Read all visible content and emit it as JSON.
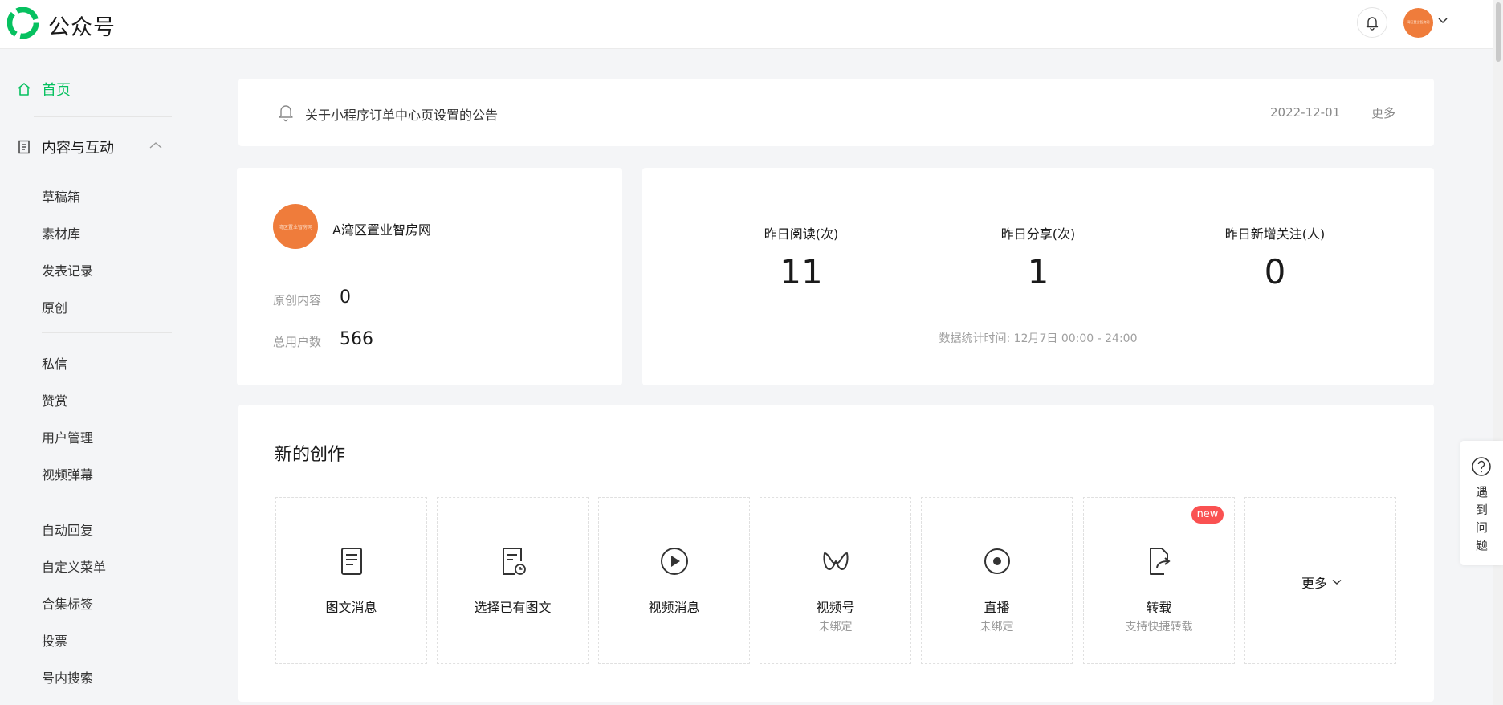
{
  "header": {
    "brand": "公众号",
    "account_avatar_text": "湾区置业智房网",
    "icons": [
      "logo-icon",
      "bell-icon",
      "chevron-down-icon"
    ]
  },
  "sidebar": {
    "home": "首页",
    "group": "内容与互动",
    "items": [
      "草稿箱",
      "素材库",
      "发表记录",
      "原创",
      "私信",
      "赞赏",
      "用户管理",
      "视频弹幕",
      "自动回复",
      "自定义菜单",
      "合集标签",
      "投票",
      "号内搜索"
    ],
    "active_color": "#07c160"
  },
  "notice": {
    "text": "关于小程序订单中心页设置的公告",
    "date": "2022-12-01",
    "more": "更多"
  },
  "account": {
    "avatar_text": "湾区置业智房网",
    "name": "A湾区置业智房网",
    "stats": [
      {
        "label": "原创内容",
        "value": "0"
      },
      {
        "label": "总用户数",
        "value": "566"
      }
    ]
  },
  "metrics": {
    "items": [
      {
        "label": "昨日阅读(次)",
        "value": "11"
      },
      {
        "label": "昨日分享(次)",
        "value": "1"
      },
      {
        "label": "昨日新增关注(人)",
        "value": "0"
      }
    ],
    "footnote": "数据统计时间: 12月7日 00:00 - 24:00"
  },
  "create": {
    "title": "新的创作",
    "tiles": [
      {
        "label": "图文消息",
        "sub": "",
        "icon": "article-icon"
      },
      {
        "label": "选择已有图文",
        "sub": "",
        "icon": "existing-article-icon"
      },
      {
        "label": "视频消息",
        "sub": "",
        "icon": "video-icon"
      },
      {
        "label": "视频号",
        "sub": "未绑定",
        "icon": "channels-icon"
      },
      {
        "label": "直播",
        "sub": "未绑定",
        "icon": "live-icon"
      },
      {
        "label": "转载",
        "sub": "支持快捷转载",
        "icon": "repost-icon"
      }
    ],
    "new_badge": "new",
    "more": "更多"
  },
  "help": {
    "text": "遇到问题"
  },
  "colors": {
    "accent": "#07c160",
    "avatar": "#ef7c3b",
    "badge": "#fa5151"
  }
}
